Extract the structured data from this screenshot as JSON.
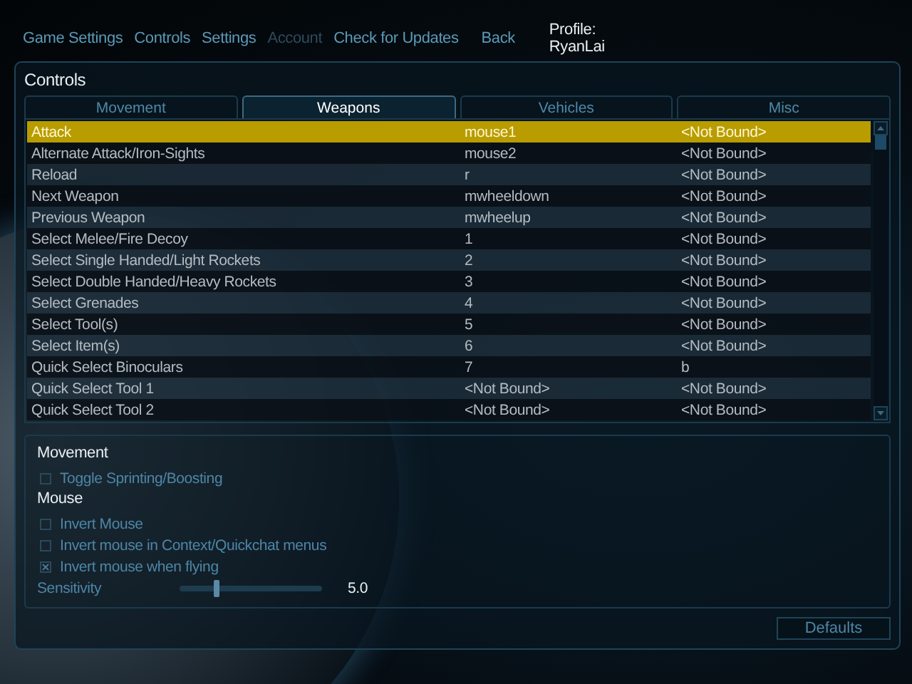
{
  "nav": [
    {
      "label": "Game Settings",
      "disabled": false
    },
    {
      "label": "Controls",
      "disabled": false
    },
    {
      "label": "Settings",
      "disabled": false
    },
    {
      "label": "Account",
      "disabled": true
    },
    {
      "label": "Check for Updates",
      "disabled": false
    }
  ],
  "back": "Back",
  "profile": "Profile: RyanLai",
  "panel_title": "Controls",
  "tabs": [
    {
      "label": "Movement",
      "selected": false
    },
    {
      "label": "Weapons",
      "selected": true
    },
    {
      "label": "Vehicles",
      "selected": false
    },
    {
      "label": "Misc",
      "selected": false
    }
  ],
  "bindings": [
    {
      "action": "Attack",
      "primary": "mouse1",
      "secondary": "<Not Bound>",
      "selected": true
    },
    {
      "action": "Alternate Attack/Iron-Sights",
      "primary": "mouse2",
      "secondary": "<Not Bound>",
      "selected": false
    },
    {
      "action": "Reload",
      "primary": "r",
      "secondary": "<Not Bound>",
      "selected": false
    },
    {
      "action": "Next Weapon",
      "primary": "mwheeldown",
      "secondary": "<Not Bound>",
      "selected": false
    },
    {
      "action": "Previous Weapon",
      "primary": "mwheelup",
      "secondary": "<Not Bound>",
      "selected": false
    },
    {
      "action": "Select Melee/Fire Decoy",
      "primary": "1",
      "secondary": "<Not Bound>",
      "selected": false
    },
    {
      "action": "Select Single Handed/Light Rockets",
      "primary": "2",
      "secondary": "<Not Bound>",
      "selected": false
    },
    {
      "action": "Select Double Handed/Heavy Rockets",
      "primary": "3",
      "secondary": "<Not Bound>",
      "selected": false
    },
    {
      "action": "Select Grenades",
      "primary": "4",
      "secondary": "<Not Bound>",
      "selected": false
    },
    {
      "action": "Select Tool(s)",
      "primary": "5",
      "secondary": "<Not Bound>",
      "selected": false
    },
    {
      "action": "Select Item(s)",
      "primary": "6",
      "secondary": "<Not Bound>",
      "selected": false
    },
    {
      "action": "Quick Select Binoculars",
      "primary": "7",
      "secondary": "b",
      "selected": false
    },
    {
      "action": "Quick Select Tool 1",
      "primary": "<Not Bound>",
      "secondary": "<Not Bound>",
      "selected": false
    },
    {
      "action": "Quick Select Tool 2",
      "primary": "<Not Bound>",
      "secondary": "<Not Bound>",
      "selected": false
    }
  ],
  "options": [
    {
      "kind": "heading",
      "label": "Movement"
    },
    {
      "kind": "checkbox",
      "label": "Toggle Sprinting/Boosting",
      "checked": false
    },
    {
      "kind": "heading",
      "label": "Mouse"
    },
    {
      "kind": "checkbox",
      "label": "Invert Mouse",
      "checked": false
    },
    {
      "kind": "checkbox",
      "label": "Invert mouse in Context/Quickchat menus",
      "checked": false
    },
    {
      "kind": "checkbox",
      "label": "Invert mouse when flying",
      "checked": true
    },
    {
      "kind": "slider",
      "label": "Sensitivity",
      "level": 0.26,
      "reading": "5.0"
    }
  ],
  "defaults_button": "Defaults"
}
